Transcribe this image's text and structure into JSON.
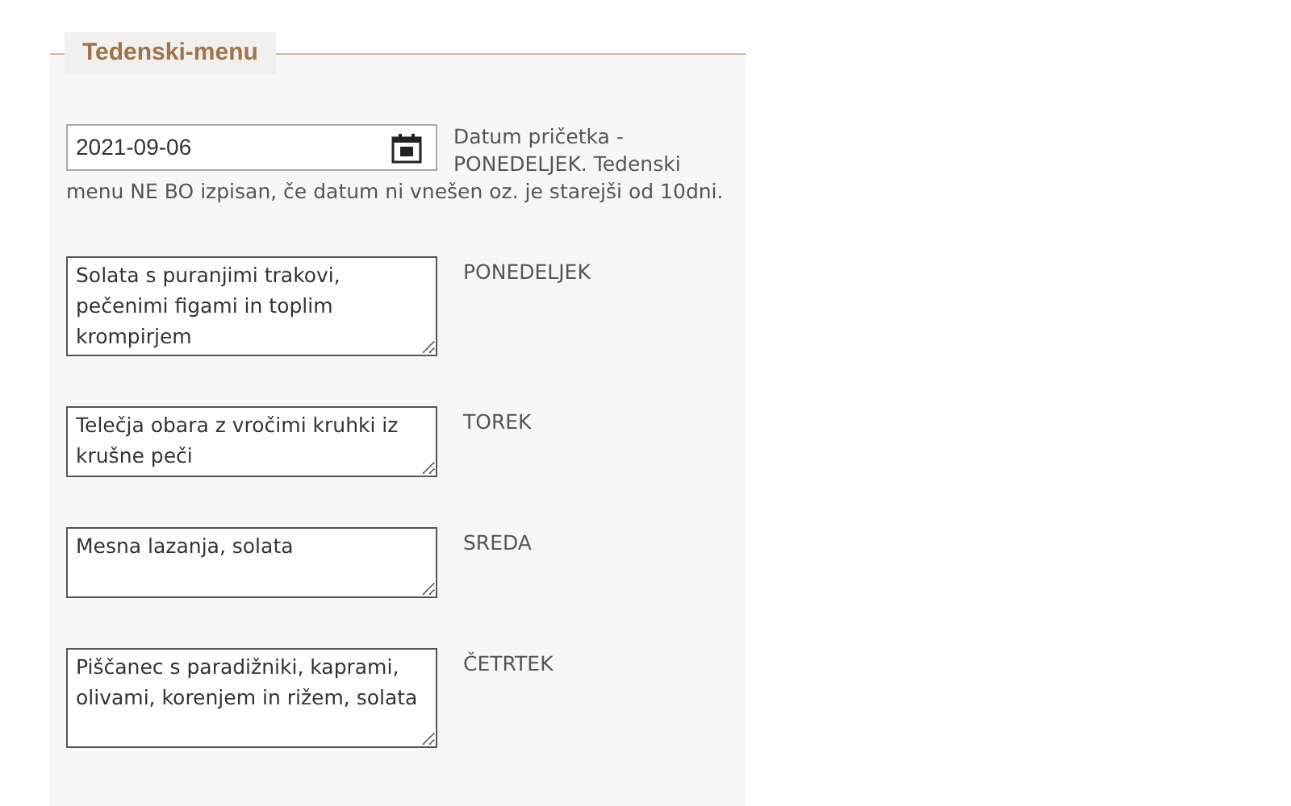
{
  "section": {
    "title": "Tedenski-menu"
  },
  "start_date": {
    "value": "2021-09-06",
    "help": [
      "Datum pričetka - PONEDELJEK. Tedenski",
      "menu NE BO izpisan, če datum ni vnešen oz. je starejši od 10dni."
    ]
  },
  "days": [
    {
      "label": "PONEDELJEK",
      "menu": "Solata s puranjimi trakovi, pečenimi figami in toplim krompirjem"
    },
    {
      "label": "TOREK",
      "menu": "Telečja obara z vročimi kruhki iz krušne peči"
    },
    {
      "label": "SREDA",
      "menu": "Mesna lazanja, solata"
    },
    {
      "label": "ČETRTEK",
      "menu": "Piščanec s paradižniki, kaprami, olivami, korenjem in rižem, solata"
    }
  ]
}
